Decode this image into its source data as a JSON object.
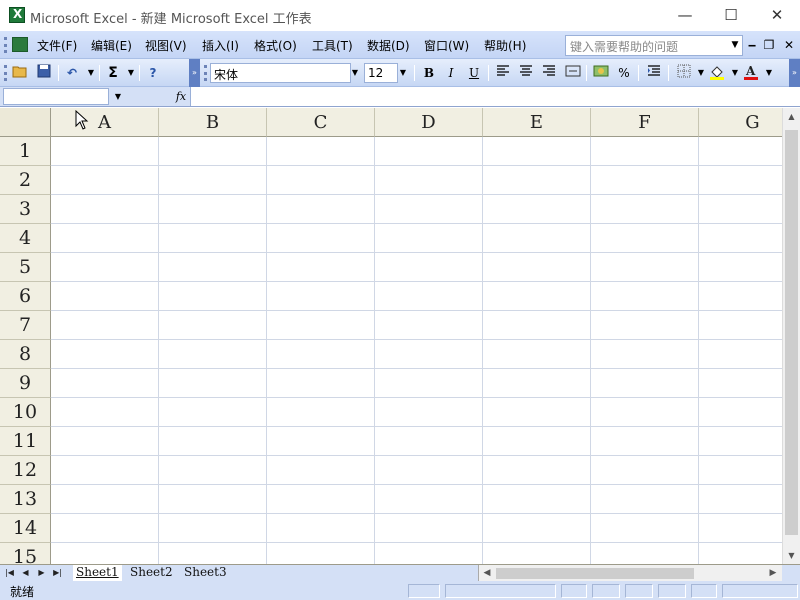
{
  "window": {
    "title": "Microsoft Excel - 新建 Microsoft Excel 工作表",
    "minimize": "—",
    "maximize": "☐",
    "close": "✕"
  },
  "menu": {
    "items": [
      "文件(F)",
      "编辑(E)",
      "视图(V)",
      "插入(I)",
      "格式(O)",
      "工具(T)",
      "数据(D)",
      "窗口(W)",
      "帮助(H)"
    ],
    "help_placeholder": "键入需要帮助的问题",
    "doc_minimize": "‒",
    "doc_restore": "❐",
    "doc_close": "✕"
  },
  "toolbar": {
    "font_name": "宋体",
    "font_size": "12",
    "bold": "B",
    "italic": "I",
    "underline": "U",
    "sum": "Σ",
    "percent": "%"
  },
  "formula": {
    "name_box": "",
    "fx": "fx",
    "value": ""
  },
  "grid": {
    "columns": [
      "A",
      "B",
      "C",
      "D",
      "E",
      "F",
      "G"
    ],
    "rows": [
      "1",
      "2",
      "3",
      "4",
      "5",
      "6",
      "7",
      "8",
      "9",
      "10",
      "11",
      "12",
      "13",
      "14",
      "15"
    ]
  },
  "sheets": {
    "tabs": [
      "Sheet1",
      "Sheet2",
      "Sheet3"
    ],
    "active": "Sheet1"
  },
  "status": {
    "text": "就绪"
  }
}
